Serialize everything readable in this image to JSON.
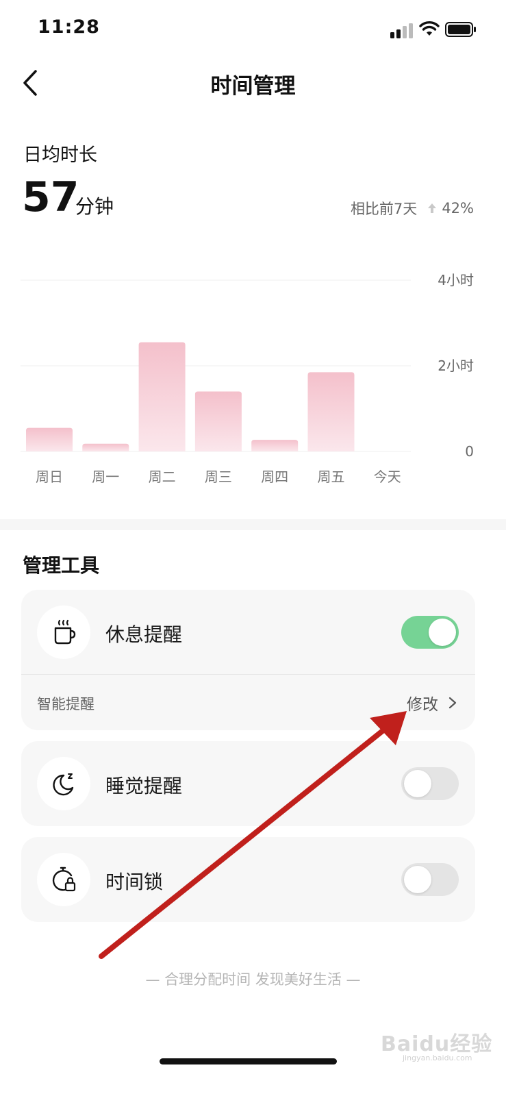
{
  "status_bar": {
    "time": "11:28"
  },
  "header": {
    "title": "时间管理"
  },
  "summary": {
    "label": "日均时长",
    "value": "57",
    "unit": "分钟",
    "compare_label": "相比前7天",
    "compare_value": "42%",
    "compare_direction": "up"
  },
  "chart_data": {
    "type": "bar",
    "categories": [
      "周日",
      "周一",
      "周二",
      "周三",
      "周四",
      "周五",
      "今天"
    ],
    "values": [
      0.55,
      0.18,
      2.55,
      1.4,
      0.27,
      1.85,
      0
    ],
    "y_ticks": [
      "4小时",
      "2小时",
      "0"
    ],
    "ylim": [
      0,
      4
    ],
    "grid": true,
    "bar_color": "#f5c3cd"
  },
  "tools": {
    "title": "管理工具",
    "items": [
      {
        "label": "休息提醒",
        "icon": "coffee-cup-icon",
        "enabled": true,
        "sub_label": "智能提醒",
        "sub_action": "修改"
      },
      {
        "label": "睡觉提醒",
        "icon": "moon-sleep-icon",
        "enabled": false
      },
      {
        "label": "时间锁",
        "icon": "timer-lock-icon",
        "enabled": false
      }
    ]
  },
  "footer": {
    "slogan": "— 合理分配时间 发现美好生活 —"
  },
  "watermark": {
    "text": "Baidu经验",
    "sub": "jingyan.baidu.com"
  },
  "colors": {
    "toggle_on": "#76d395",
    "toggle_off": "#e4e4e4",
    "annotation": "#c0201c"
  }
}
